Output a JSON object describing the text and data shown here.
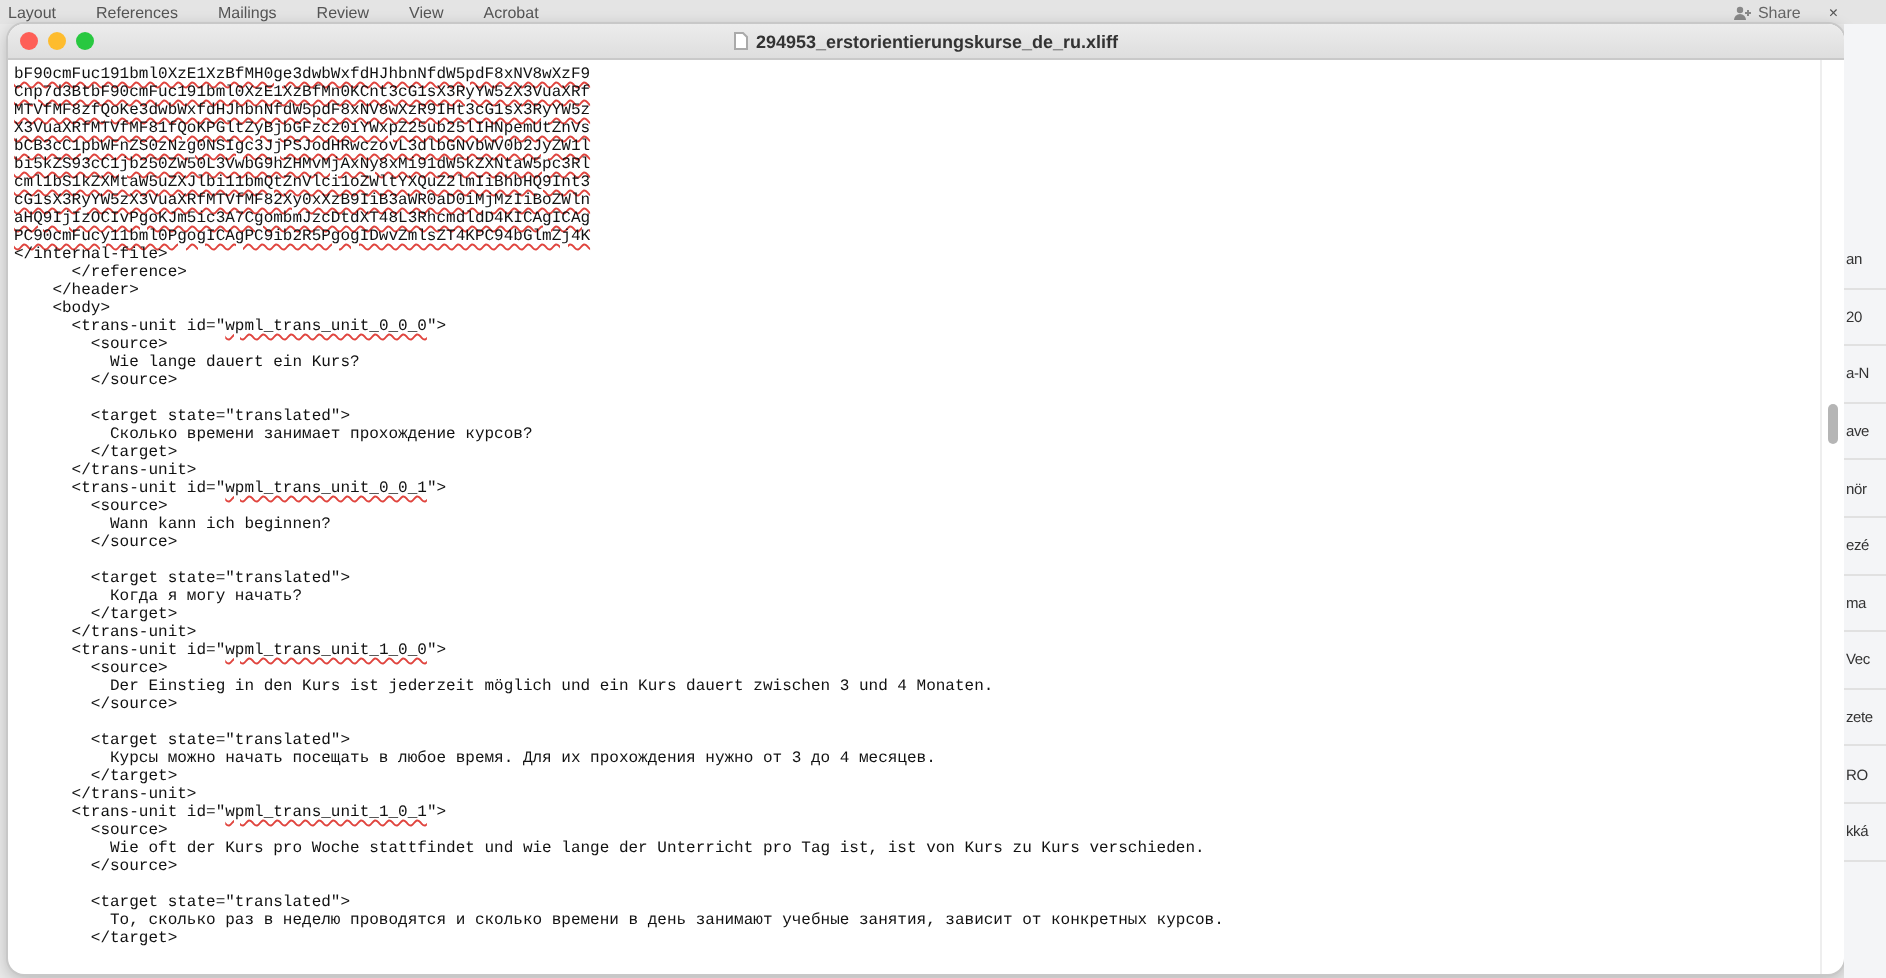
{
  "background_app": {
    "menu": [
      "Layout",
      "References",
      "Mailings",
      "Review",
      "View",
      "Acrobat"
    ],
    "share": "Share",
    "close": "×",
    "fragments": [
      "an",
      "20",
      "a-N",
      "ave",
      "nör",
      "ezé",
      "ma",
      "Vec",
      "zete",
      "RO",
      "kká"
    ]
  },
  "window": {
    "title": "294953_erstorientierungskurse_de_ru.xliff"
  },
  "lines": [
    [
      {
        "text": "bF90cmFuc191bml0XzE1XzBfMH0ge3dwbWxfdHJhbnNfdW5pdF8xNV8wXzF9",
        "misspelled": true
      }
    ],
    [
      {
        "text": "Cnp7d3BtbF90cmFuc191bml0XzE1XzBfMn0KCnt3cG1sX3RyYW5zX3VuaXRf",
        "misspelled": true
      }
    ],
    [
      {
        "text": "MTVfMF8zfQoKe3dwbWxfdHJhbnNfdW5pdF8xNV8wXzR9IHt3cG1sX3RyYW5z",
        "misspelled": true
      }
    ],
    [
      {
        "text": "X3VuaXRfMTVfMF81fQoKPGltZyBjbGFzcz0iYWxpZ25ub25lIHNpemUtZnVs",
        "misspelled": true
      }
    ],
    [
      {
        "text": "bCB3cC1pbWFnZS0zNzg0NSIgc3JjPSJodHRwczovL3dlbGNvbWV0b2JyZW1l",
        "misspelled": true
      }
    ],
    [
      {
        "text": "bi5kZS93cC1jb250ZW50L3VwbG9hZHMvMjAxNy8xMi91dW5kZXNtaW5pc3Rl",
        "misspelled": true
      }
    ],
    [
      {
        "text": "cml1bS1kZXMtaW5uZXJlbi11bmQtZnVlci1oZWltYXQuZ2lmIiBhbHQ9Int3",
        "misspelled": true
      }
    ],
    [
      {
        "text": "cG1sX3RyYW5zX3VuaXRfMTVfMF82Xy0xXzB9IiB3aWR0aD0iMjMzIiBoZWln",
        "misspelled": true
      }
    ],
    [
      {
        "text": "aHQ9IjIzOCIvPgoKJm5ic3A7CgombmJzcDtdXT48L3RhcmdldD4KICAgICAg",
        "misspelled": true
      }
    ],
    [
      {
        "text": "PC90cmFucy11bml0PgogICAgPC9ib2R5PgogIDwvZmlsZT4KPC94bGlmZj4K",
        "misspelled": true
      }
    ],
    [
      {
        "text": "</internal-file>",
        "misspelled": false
      }
    ],
    [
      {
        "text": "      </reference>",
        "misspelled": false
      }
    ],
    [
      {
        "text": "    </header>",
        "misspelled": false
      }
    ],
    [
      {
        "text": "    <body>",
        "misspelled": false
      }
    ],
    [
      {
        "text": "      <trans-unit id=\"",
        "misspelled": false
      },
      {
        "text": "wpml_trans_unit_0_0_0",
        "misspelled": true
      },
      {
        "text": "\">",
        "misspelled": false
      }
    ],
    [
      {
        "text": "        <source>",
        "misspelled": false
      }
    ],
    [
      {
        "text": "          Wie lange dauert ein Kurs?",
        "misspelled": false
      }
    ],
    [
      {
        "text": "        </source>",
        "misspelled": false
      }
    ],
    {
      "kind": "blank"
    },
    [
      {
        "text": "        <target state=\"translated\">",
        "misspelled": false
      }
    ],
    [
      {
        "text": "          Сколько времени занимает прохождение курсов?",
        "misspelled": false
      }
    ],
    [
      {
        "text": "        </target>",
        "misspelled": false
      }
    ],
    [
      {
        "text": "      </trans-unit>",
        "misspelled": false
      }
    ],
    [
      {
        "text": "      <trans-unit id=\"",
        "misspelled": false
      },
      {
        "text": "wpml_trans_unit_0_0_1",
        "misspelled": true
      },
      {
        "text": "\">",
        "misspelled": false
      }
    ],
    [
      {
        "text": "        <source>",
        "misspelled": false
      }
    ],
    [
      {
        "text": "          Wann kann ich beginnen?",
        "misspelled": false
      }
    ],
    [
      {
        "text": "        </source>",
        "misspelled": false
      }
    ],
    {
      "kind": "blank"
    },
    [
      {
        "text": "        <target state=\"translated\">",
        "misspelled": false
      }
    ],
    [
      {
        "text": "          Когда я могу начать?",
        "misspelled": false
      }
    ],
    [
      {
        "text": "        </target>",
        "misspelled": false
      }
    ],
    [
      {
        "text": "      </trans-unit>",
        "misspelled": false
      }
    ],
    [
      {
        "text": "      <trans-unit id=\"",
        "misspelled": false
      },
      {
        "text": "wpml_trans_unit_1_0_0",
        "misspelled": true
      },
      {
        "text": "\">",
        "misspelled": false
      }
    ],
    [
      {
        "text": "        <source>",
        "misspelled": false
      }
    ],
    [
      {
        "text": "          Der Einstieg in den Kurs ist jederzeit möglich und ein Kurs dauert zwischen 3 und 4 Monaten.",
        "misspelled": false
      }
    ],
    [
      {
        "text": "        </source>",
        "misspelled": false
      }
    ],
    {
      "kind": "blank"
    },
    [
      {
        "text": "        <target state=\"translated\">",
        "misspelled": false
      }
    ],
    [
      {
        "text": "          Курсы можно начать посещать в любое время. Для их прохождения нужно от 3 до 4 месяцев.",
        "misspelled": false
      }
    ],
    [
      {
        "text": "        </target>",
        "misspelled": false
      }
    ],
    [
      {
        "text": "      </trans-unit>",
        "misspelled": false
      }
    ],
    [
      {
        "text": "      <trans-unit id=\"",
        "misspelled": false
      },
      {
        "text": "wpml_trans_unit_1_0_1",
        "misspelled": true
      },
      {
        "text": "\">",
        "misspelled": false
      }
    ],
    [
      {
        "text": "        <source>",
        "misspelled": false
      }
    ],
    [
      {
        "text": "          Wie oft der Kurs pro Woche stattfindet und wie lange der Unterricht pro Tag ist, ist von Kurs zu Kurs verschieden.",
        "misspelled": false
      }
    ],
    [
      {
        "text": "        </source>",
        "misspelled": false
      }
    ],
    {
      "kind": "blank"
    },
    [
      {
        "text": "        <target state=\"translated\">",
        "misspelled": false
      }
    ],
    [
      {
        "text": "          То, сколько раз в неделю проводятся и сколько времени в день занимают учебные занятия, зависит от конкретных курсов.",
        "misspelled": false
      }
    ],
    [
      {
        "text": "        </target>",
        "misspelled": false
      }
    ]
  ]
}
